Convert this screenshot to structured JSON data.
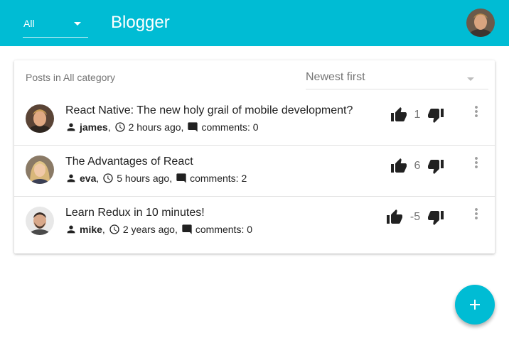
{
  "appbar": {
    "category_value": "All",
    "title": "Blogger",
    "user_avatar": "user-avatar-icon"
  },
  "list": {
    "header_label": "Posts in All category",
    "sort_value": "Newest first"
  },
  "posts": [
    {
      "title": "React Native: The new holy grail of mobile development?",
      "author": "james",
      "time": "2 hours ago",
      "comments": "comments: 0",
      "score": "1"
    },
    {
      "title": "The Advantages of React",
      "author": "eva",
      "time": "5 hours ago",
      "comments": "comments: 2",
      "score": "6"
    },
    {
      "title": "Learn Redux in 10 minutes!",
      "author": "mike",
      "time": "2 years ago",
      "comments": "comments: 0",
      "score": "-5"
    }
  ],
  "colors": {
    "primary": "#00bcd4",
    "text": "#212121",
    "secondary_text": "#757575"
  },
  "icons": {
    "fab": "add-icon",
    "upvote": "thumb-up-icon",
    "downvote": "thumb-down-icon",
    "more": "more-vert-icon"
  }
}
